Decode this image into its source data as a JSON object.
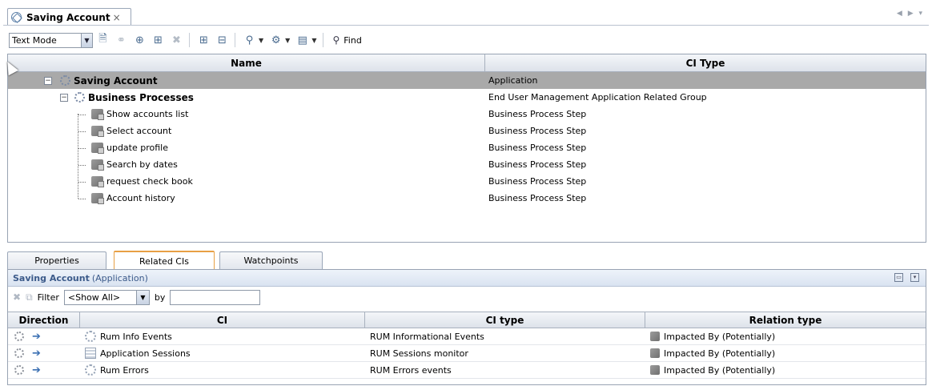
{
  "editor": {
    "tab_title": "Saving Account",
    "tab_close": "×",
    "nav_arrows": "◀ ▶ ▾"
  },
  "toolbar": {
    "mode_value": "Text Mode",
    "find_label": "Find",
    "buttons": [
      "properties-icon",
      "link-icon",
      "add-ci-icon",
      "add-related-icon",
      "delete-icon",
      "expand-icon",
      "collapse-icon",
      "filter-icon",
      "show-icon",
      "layout-icon",
      "search-icon"
    ]
  },
  "tree": {
    "columns": {
      "name": "Name",
      "ci_type": "CI Type"
    },
    "rows": [
      {
        "name": "Saving Account",
        "type": "Application",
        "level": 0,
        "bold": true,
        "selected": true,
        "icon": "gear-icon"
      },
      {
        "name": "Business Processes",
        "type": "End User Management Application Related Group",
        "level": 1,
        "bold": true,
        "selected": false,
        "icon": "gear-icon"
      },
      {
        "name": "Show accounts list",
        "type": "Business Process Step",
        "level": 2,
        "bold": false,
        "icon": "step-icon"
      },
      {
        "name": "Select account",
        "type": "Business Process Step",
        "level": 2,
        "bold": false,
        "icon": "step-icon"
      },
      {
        "name": "update profile",
        "type": "Business Process Step",
        "level": 2,
        "bold": false,
        "icon": "step-icon"
      },
      {
        "name": "Search by dates",
        "type": "Business Process Step",
        "level": 2,
        "bold": false,
        "icon": "step-icon"
      },
      {
        "name": "request check book",
        "type": "Business Process Step",
        "level": 2,
        "bold": false,
        "icon": "step-icon"
      },
      {
        "name": "Account history",
        "type": "Business Process Step",
        "level": 2,
        "bold": false,
        "icon": "step-icon"
      }
    ]
  },
  "bottom_tabs": {
    "tabs": [
      {
        "label": "Properties",
        "active": false
      },
      {
        "label": "Related CIs",
        "active": true
      },
      {
        "label": "Watchpoints",
        "active": false
      }
    ]
  },
  "panel": {
    "title_name": "Saving Account",
    "title_type": "(Application)",
    "filter_label": "Filter",
    "filter_value": "<Show All>",
    "by_label": "by",
    "by_value": ""
  },
  "related": {
    "columns": {
      "direction": "Direction",
      "ci": "CI",
      "ci_type": "CI type",
      "relation": "Relation type"
    },
    "rows": [
      {
        "ci": "Rum Info Events",
        "ci_type": "RUM Informational Events",
        "relation": "Impacted By (Potentially)",
        "ci_icon": "dots"
      },
      {
        "ci": "Application Sessions",
        "ci_type": "RUM Sessions monitor",
        "relation": "Impacted By (Potentially)",
        "ci_icon": "grid"
      },
      {
        "ci": "Rum Errors",
        "ci_type": "RUM Errors events",
        "relation": "Impacted By (Potentially)",
        "ci_icon": "dots"
      }
    ]
  }
}
